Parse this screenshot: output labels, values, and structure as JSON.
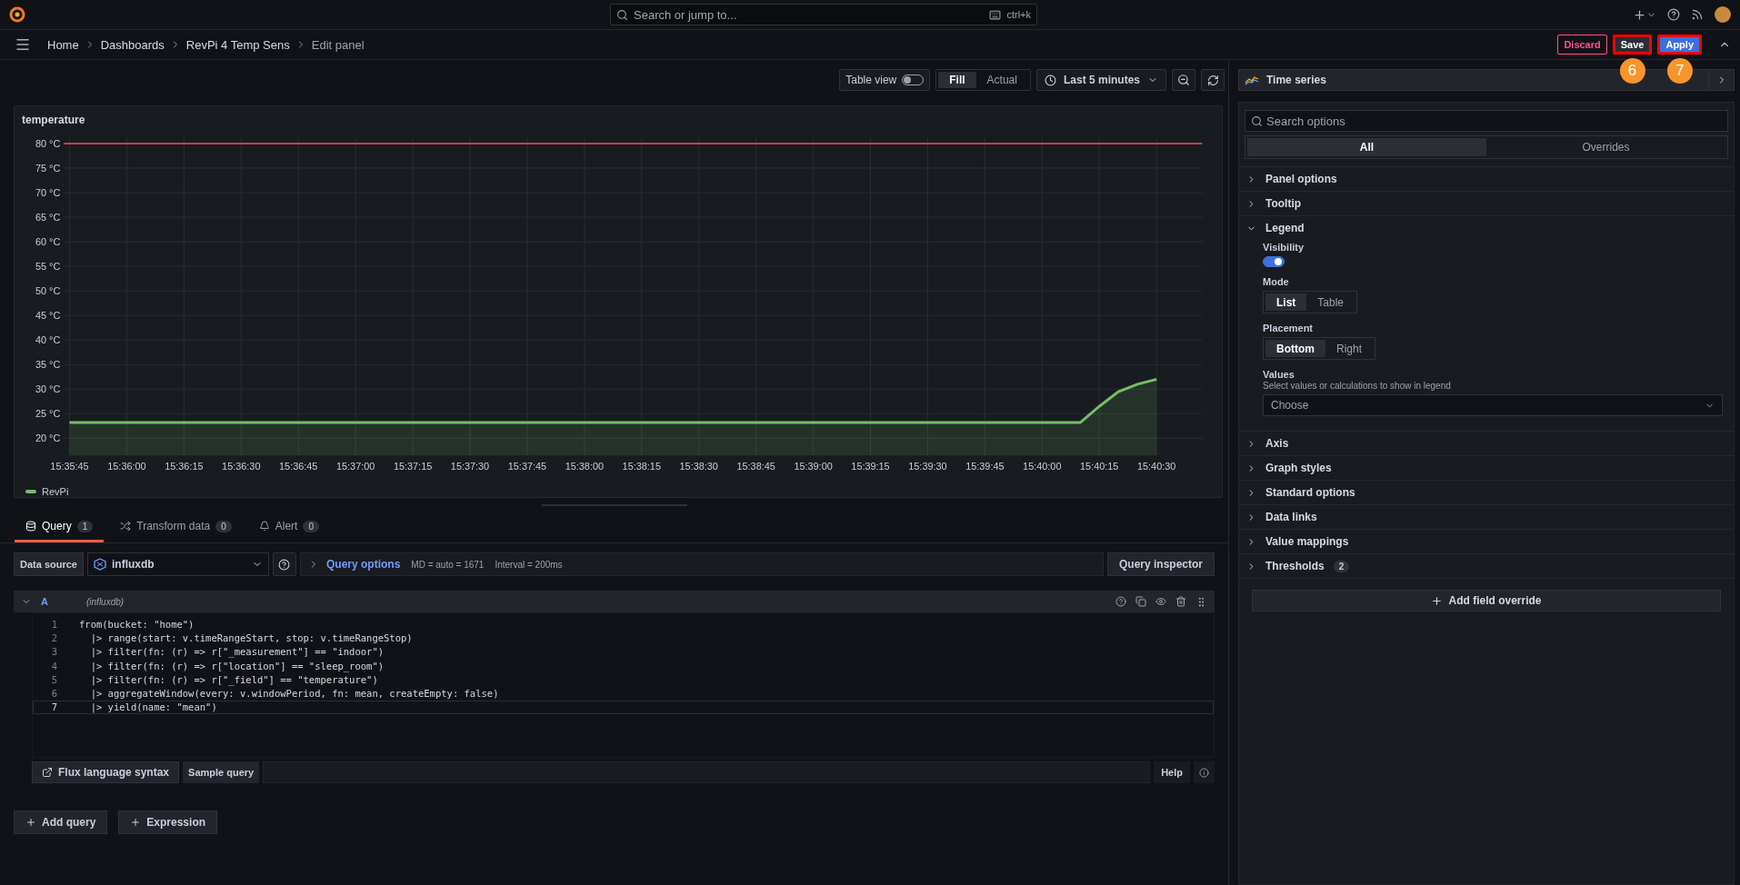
{
  "topbar": {
    "search_placeholder": "Search or jump to...",
    "shortcut": "ctrl+k"
  },
  "breadcrumbs": [
    "Home",
    "Dashboards",
    "RevPi 4 Temp Sens",
    "Edit panel"
  ],
  "actions": [
    {
      "label": "Discard",
      "kind": "discard",
      "highlighted": false
    },
    {
      "label": "Save",
      "kind": "save",
      "highlighted": true,
      "callout": "6"
    },
    {
      "label": "Apply",
      "kind": "apply",
      "highlighted": true,
      "callout": "7"
    }
  ],
  "toolbar": {
    "table_view": {
      "label": "Table view",
      "on": false
    },
    "fit": [
      {
        "label": "Fill",
        "selected": true
      },
      {
        "label": "Actual",
        "selected": false
      }
    ],
    "time_range": "Last 5 minutes"
  },
  "panel": {
    "title": "temperature",
    "chart_data": {
      "type": "area",
      "grid": true,
      "categories": [
        "15:35:45",
        null,
        null,
        "15:36:00",
        null,
        null,
        "15:36:15",
        null,
        null,
        "15:36:30",
        null,
        null,
        "15:36:45",
        null,
        null,
        "15:37:00",
        null,
        null,
        "15:37:15",
        null,
        null,
        "15:37:30",
        null,
        null,
        "15:37:45",
        null,
        null,
        "15:38:00",
        null,
        null,
        "15:38:15",
        null,
        null,
        "15:38:30",
        null,
        null,
        "15:38:45",
        null,
        null,
        "15:39:00",
        null,
        null,
        "15:39:15",
        null,
        null,
        "15:39:30",
        null,
        null,
        "15:39:45",
        null,
        null,
        "15:40:00",
        null,
        null,
        "15:40:15",
        null,
        null,
        "15:40:30",
        null
      ],
      "ylim": [
        16.5,
        81.3
      ],
      "yticks": [
        {
          "value": 20,
          "label": "20 °C"
        },
        {
          "value": 25,
          "label": "25 °C"
        },
        {
          "value": 30,
          "label": "30 °C"
        },
        {
          "value": 35,
          "label": "35 °C"
        },
        {
          "value": 40,
          "label": "40 °C"
        },
        {
          "value": 45,
          "label": "45 °C"
        },
        {
          "value": 50,
          "label": "50 °C"
        },
        {
          "value": 55,
          "label": "55 °C"
        },
        {
          "value": 60,
          "label": "60 °C"
        },
        {
          "value": 65,
          "label": "65 °C"
        },
        {
          "value": 70,
          "label": "70 °C"
        },
        {
          "value": 75,
          "label": "75 °C"
        },
        {
          "value": 80,
          "label": "80 °C"
        }
      ],
      "series": [
        {
          "name": "RevPi",
          "color": "#73bf69",
          "values": [
            23.2,
            23.2,
            23.2,
            23.2,
            23.2,
            23.2,
            23.2,
            23.2,
            23.2,
            23.2,
            23.2,
            23.2,
            23.2,
            23.2,
            23.2,
            23.2,
            23.2,
            23.2,
            23.2,
            23.2,
            23.2,
            23.2,
            23.2,
            23.2,
            23.2,
            23.2,
            23.2,
            23.2,
            23.2,
            23.2,
            23.2,
            23.2,
            23.2,
            23.2,
            23.2,
            23.2,
            23.2,
            23.2,
            23.2,
            23.2,
            23.2,
            23.2,
            23.2,
            23.2,
            23.2,
            23.2,
            23.2,
            23.2,
            23.2,
            23.2,
            23.2,
            23.2,
            23.2,
            23.2,
            26.5,
            29.5,
            31,
            32,
            null
          ]
        }
      ],
      "ref_lines": [
        {
          "axis": "y",
          "value": 80,
          "color": "#f2495c"
        }
      ]
    }
  },
  "query_tabs": [
    {
      "label": "Query",
      "count": "1",
      "kind": "query",
      "selected": true
    },
    {
      "label": "Transform data",
      "count": "0",
      "kind": "transform",
      "selected": false
    },
    {
      "label": "Alert",
      "count": "0",
      "kind": "alert",
      "selected": false
    }
  ],
  "data_source": {
    "label": "Data source",
    "value": "influxdb"
  },
  "query_options": {
    "label": "Query options",
    "md": "MD = auto = 1671",
    "interval": "Interval = 200ms"
  },
  "query_inspector": "Query inspector",
  "query": {
    "ref": "A",
    "source": "(influxdb)",
    "expanded": true,
    "lines": [
      {
        "number": "1",
        "code": "from(bucket: \"home\")",
        "selected": false
      },
      {
        "number": "2",
        "code": "  |> range(start: v.timeRangeStart, stop: v.timeRangeStop)",
        "selected": false
      },
      {
        "number": "3",
        "code": "  |> filter(fn: (r) => r[\"_measurement\"] == \"indoor\")",
        "selected": false
      },
      {
        "number": "4",
        "code": "  |> filter(fn: (r) => r[\"location\"] == \"sleep_room\")",
        "selected": false
      },
      {
        "number": "5",
        "code": "  |> filter(fn: (r) => r[\"_field\"] == \"temperature\")",
        "selected": false
      },
      {
        "number": "6",
        "code": "  |> aggregateWindow(every: v.windowPeriod, fn: mean, createEmpty: false)",
        "selected": false
      },
      {
        "number": "7",
        "code": "  |> yield(name: \"mean\")",
        "selected": true
      }
    ]
  },
  "editor_footer": {
    "syntax_link": "Flux language syntax",
    "sample_query": "Sample query",
    "help": "Help"
  },
  "add_buttons": [
    "Add query",
    "Expression"
  ],
  "viz_picker": "Time series",
  "options": {
    "search_placeholder": "Search options",
    "tabs": [
      {
        "label": "All",
        "selected": true
      },
      {
        "label": "Overrides",
        "selected": false
      }
    ],
    "sections": [
      {
        "title": "Panel options",
        "expanded": false
      },
      {
        "title": "Tooltip",
        "expanded": false
      },
      {
        "title": "Legend",
        "expanded": true,
        "fields": [
          {
            "kind": "toggle",
            "label": "Visibility",
            "on": true
          },
          {
            "kind": "radio",
            "label": "Mode",
            "options": [
              {
                "label": "List",
                "selected": true
              },
              {
                "label": "Table",
                "selected": false
              }
            ]
          },
          {
            "kind": "radio",
            "label": "Placement",
            "options": [
              {
                "label": "Bottom",
                "selected": true
              },
              {
                "label": "Right",
                "selected": false
              }
            ]
          },
          {
            "kind": "select",
            "label": "Values",
            "description": "Select values or calculations to show in legend",
            "placeholder": "Choose"
          }
        ]
      },
      {
        "title": "Axis",
        "expanded": false
      },
      {
        "title": "Graph styles",
        "expanded": false
      },
      {
        "title": "Standard options",
        "expanded": false
      },
      {
        "title": "Data links",
        "expanded": false
      },
      {
        "title": "Value mappings",
        "expanded": false
      },
      {
        "title": "Thresholds",
        "expanded": false,
        "count": "2"
      }
    ],
    "add_override": "Add field override"
  }
}
